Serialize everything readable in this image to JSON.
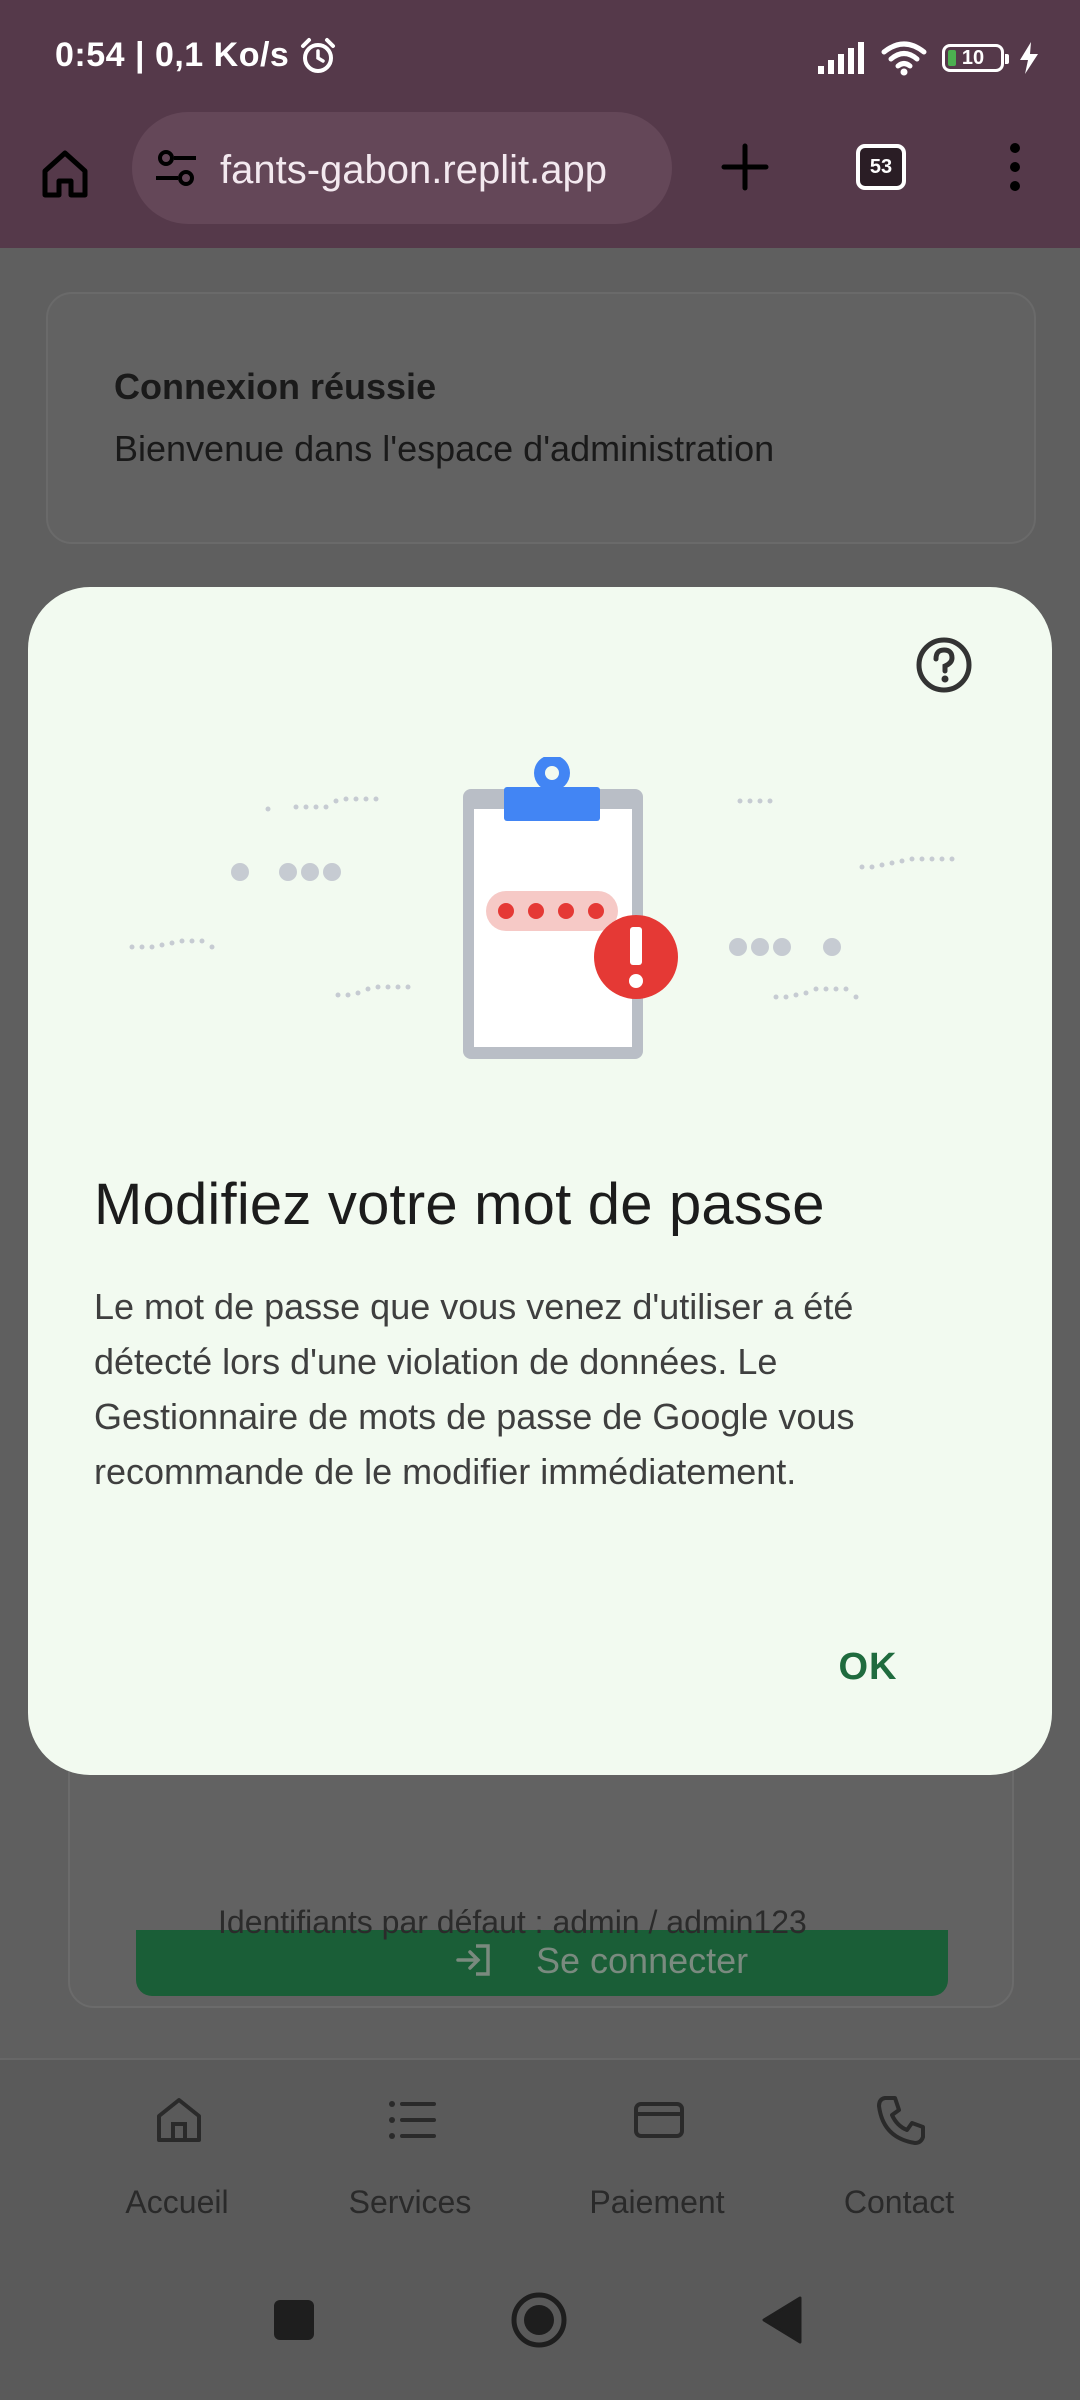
{
  "status_bar": {
    "time": "0:54 | 0,1 Ko/s",
    "battery": "10"
  },
  "browser": {
    "url": "fants-gabon.replit.app",
    "tab_count": "53"
  },
  "page": {
    "toast_title": "Connexion réussie",
    "toast_message": "Bienvenue dans l'espace d'administration",
    "login_button": "Se connecter",
    "credentials_hint": "Identifiants par défaut : admin / admin123"
  },
  "bottom_nav": [
    {
      "label": "Accueil",
      "icon": "home-icon"
    },
    {
      "label": "Services",
      "icon": "list-icon"
    },
    {
      "label": "Paiement",
      "icon": "credit-card-icon"
    },
    {
      "label": "Contact",
      "icon": "phone-icon"
    }
  ],
  "dialog": {
    "title": "Modifiez votre mot de passe",
    "body": "Le mot de passe que vous venez d'utiliser a été détecté lors d'une violation de données. Le Gestionnaire de mots de passe de Google vous recommande de le modifier immédiatement.",
    "ok_label": "OK"
  },
  "colors": {
    "browser_toolbar": "#55394a",
    "dialog_background": "#f2faf0",
    "ok_text": "#1f6b3e",
    "alert_red": "#e53935",
    "clipboard_blue": "#4285f4"
  }
}
